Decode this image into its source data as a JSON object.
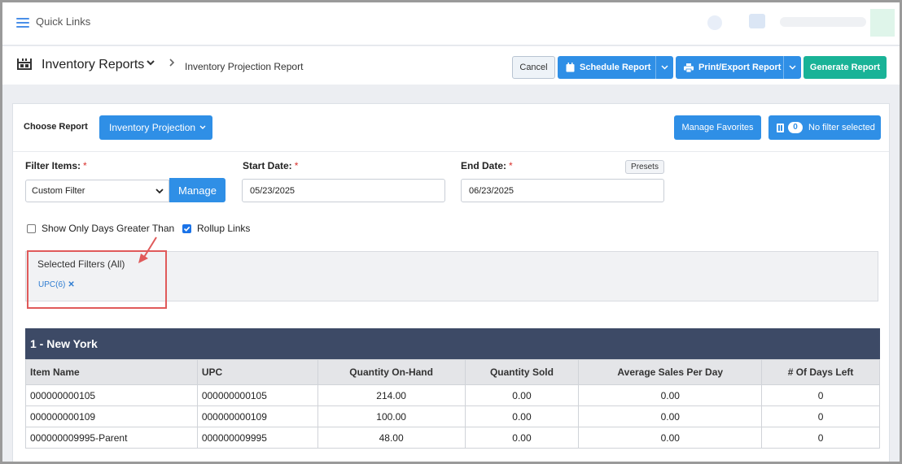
{
  "topbar": {
    "quick_links": "Quick Links"
  },
  "header": {
    "title": "Inventory Reports",
    "subtitle": "Inventory Projection Report",
    "cancel": "Cancel",
    "schedule": "Schedule Report",
    "print_export": "Print/Export Report",
    "generate": "Generate Report"
  },
  "card": {
    "choose_label": "Choose Report",
    "report_type": "Inventory Projection",
    "manage_favorites": "Manage Favorites",
    "filter_count": "0",
    "no_filter": "No filter selected"
  },
  "filters": {
    "filter_items_label": "Filter Items:",
    "required_mark": "*",
    "filter_select_value": "Custom Filter",
    "manage": "Manage",
    "start_label": "Start Date:",
    "start_value": "05/23/2025",
    "end_label": "End Date:",
    "end_value": "06/23/2025",
    "presets": "Presets",
    "show_only_days": "Show Only Days Greater Than",
    "show_only_days_checked": false,
    "rollup_links": "Rollup Links",
    "rollup_links_checked": true,
    "selected_title": "Selected Filters (All)",
    "selected_tag": "UPC(6)",
    "remove_glyph": "✕"
  },
  "table": {
    "group_title": "1 - New York",
    "columns": [
      "Item Name",
      "UPC",
      "Quantity On-Hand",
      "Quantity Sold",
      "Average Sales Per Day",
      "# Of Days Left"
    ],
    "rows": [
      [
        "000000000105",
        "000000000105",
        "214.00",
        "0.00",
        "0.00",
        "0"
      ],
      [
        "000000000109",
        "000000000109",
        "100.00",
        "0.00",
        "0.00",
        "0"
      ],
      [
        "000000009995-Parent",
        "000000009995",
        "48.00",
        "0.00",
        "0.00",
        "0"
      ]
    ]
  },
  "colors": {
    "primary": "#2f8fe6",
    "generate": "#19b397",
    "table_header": "#3d4a66",
    "highlight": "#e05a5a"
  }
}
